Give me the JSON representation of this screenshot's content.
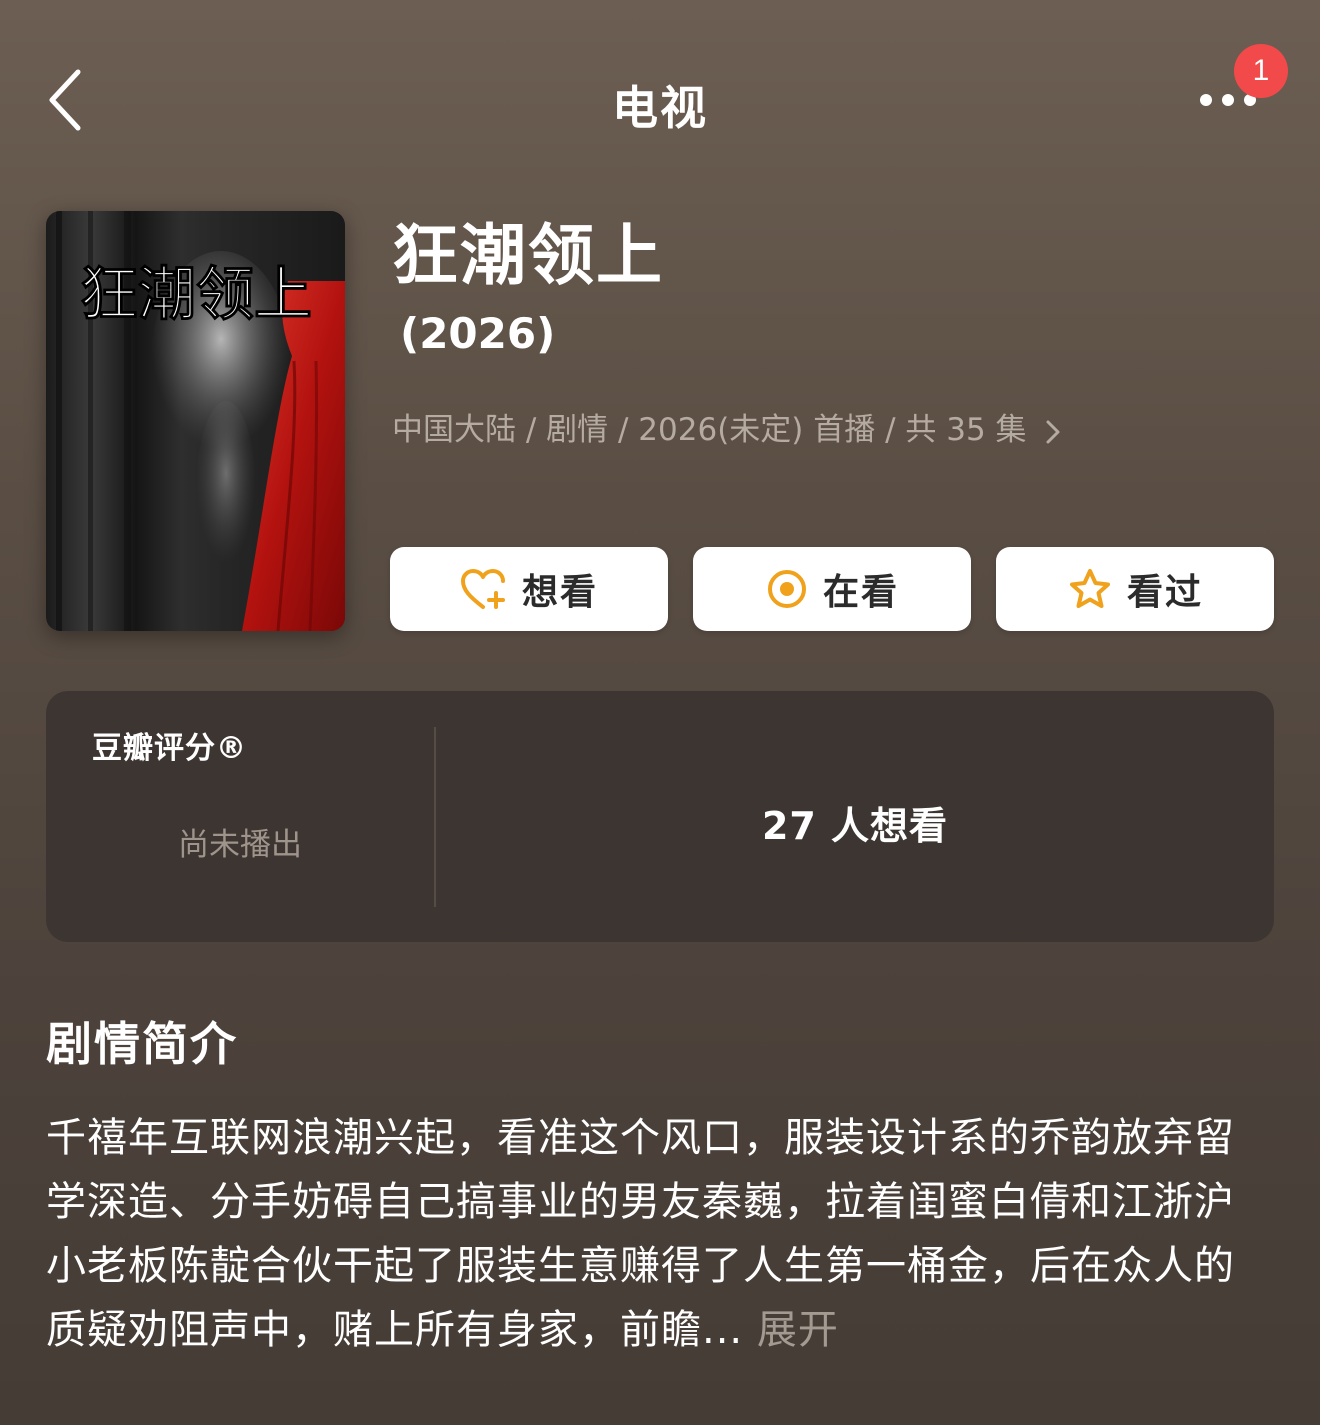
{
  "nav": {
    "title": "电视",
    "notification_count": "1"
  },
  "poster": {
    "text": "狂潮领上"
  },
  "show": {
    "title": "狂潮领上",
    "year": "(2026)",
    "meta": "中国大陆 / 剧情 / 2026(未定) 首播 / 共 35 集"
  },
  "actions": {
    "want_label": "想看",
    "watching_label": "在看",
    "watched_label": "看过"
  },
  "rating": {
    "label": "豆瓣评分®",
    "status": "尚未播出",
    "want_count": "27 人想看"
  },
  "synopsis": {
    "heading": "剧情简介",
    "text": "千禧年互联网浪潮兴起，看准这个风口，服装设计系的乔韵放弃留学深造、分手妨碍自己搞事业的男友秦巍，拉着闺蜜白倩和江浙沪小老板陈靛合伙干起了服装生意赚得了人生第一桶金，后在众人的质疑劝阻声中，赌上所有身家，前瞻...",
    "expand_label": " 展开"
  },
  "colors": {
    "accent": "#f0a21c",
    "badge": "#f24a4a",
    "background": "#5a4e44",
    "card": "#3d3531"
  },
  "icons": {
    "back": "chevron-left-icon",
    "more": "more-dots-icon",
    "want": "heart-plus-icon",
    "watching": "target-circle-icon",
    "watched": "star-icon",
    "meta_arrow": "chevron-right-icon"
  }
}
